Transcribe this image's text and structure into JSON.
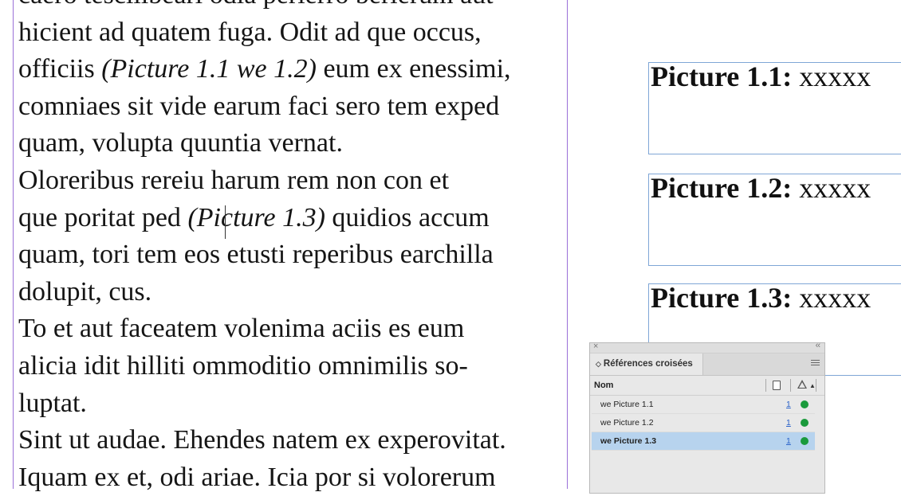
{
  "document": {
    "body_lines": [
      {
        "parts": [
          "caero tescillbearl odia perierro berierum aut"
        ]
      },
      {
        "parts": [
          "hicient ad quatem fuga. Odit ad que occus,"
        ]
      },
      {
        "parts": [
          "officiis ",
          "(Picture 1.1 we 1.2)",
          " eum ex enessimi,"
        ]
      },
      {
        "parts": [
          "comniaes sit vide earum faci sero tem exped"
        ]
      },
      {
        "parts": [
          "quam, volupta quuntia vernat."
        ]
      },
      {
        "parts": [
          "Oloreribus rereiu harum rem non con et"
        ]
      },
      {
        "parts": [
          "que poritat ped ",
          "(Picture 1.3)",
          " quidios accum"
        ]
      },
      {
        "parts": [
          "quam, tori tem eos etusti reperibus earchilla"
        ]
      },
      {
        "parts": [
          "dolupit, cus."
        ]
      },
      {
        "parts": [
          "To et aut faceatem volenima aciis es eum"
        ]
      },
      {
        "parts": [
          "alicia idit hilliti ommoditio omnimilis so-"
        ]
      },
      {
        "parts": [
          "luptat."
        ]
      },
      {
        "parts": [
          "Sint ut audae. Ehendes natem ex experovitat."
        ]
      },
      {
        "parts": [
          "Iquam ex et, odi ariae. Icia por si volorerum"
        ]
      }
    ],
    "captions": [
      {
        "label": "Picture 1.1:",
        "text": " xxxxx"
      },
      {
        "label": "Picture 1.2:",
        "text": " xxxxx"
      },
      {
        "label": "Picture 1.3:",
        "text": " xxxxx"
      }
    ]
  },
  "panel": {
    "close_glyph": "×",
    "collapse_glyph": "‹‹",
    "tab_arrows": "◇",
    "title": "Références croisées",
    "column_name": "Nom",
    "rows": [
      {
        "name": "we Picture 1.1",
        "page": "1",
        "status": "ok",
        "selected": false
      },
      {
        "name": "we Picture 1.2",
        "page": "1",
        "status": "ok",
        "selected": false
      },
      {
        "name": "we Picture 1.3",
        "page": "1",
        "status": "ok",
        "selected": true
      }
    ],
    "status_color": "#1a9a3c",
    "selection_color": "#b7d3ee"
  }
}
